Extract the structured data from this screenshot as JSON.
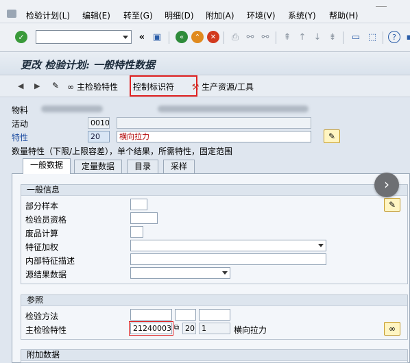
{
  "menu": {
    "items": [
      "检验计划(L)",
      "编辑(E)",
      "转至(G)",
      "明细(D)",
      "附加(A)",
      "环境(V)",
      "系统(Y)",
      "帮助(H)"
    ]
  },
  "toolbar": {
    "command_value": "",
    "icons": [
      "enter-icon",
      "back-icon",
      "save-icon",
      "back-green-icon",
      "exit-icon",
      "cancel-icon",
      "print-icon",
      "find-icon",
      "find-next-icon",
      "first-page-icon",
      "prev-page-icon",
      "next-page-icon",
      "last-page-icon",
      "new-session-icon",
      "shortcut-icon",
      "help-icon",
      "customize-icon"
    ]
  },
  "title": "更改 检验计划: 一般特性数据",
  "app_toolbar": {
    "master_char_label": "主检验特性",
    "control_indicator_label": "控制标识符",
    "prt_label": "生产资源/工具"
  },
  "header": {
    "material_label": "物料",
    "operation_label": "活动",
    "operation_value": "0010",
    "characteristic_label": "特性",
    "characteristic_value": "20",
    "characteristic_text": "横向拉力",
    "description": "数量特性（下限/上限容差），单个结果，所需特性，固定范围"
  },
  "tabs": [
    "一般数据",
    "定量数据",
    "目录",
    "采样"
  ],
  "general_info": {
    "title": "一般信息",
    "partial_sample_label": "部分样本",
    "inspector_qual_label": "检验员资格",
    "scrap_calc_label": "废品计算",
    "char_weighting_label": "特征加权",
    "internal_desc_label": "内部特征描述",
    "source_result_label": "源结果数据"
  },
  "reference": {
    "title": "参照",
    "method_label": "检验方法",
    "master_char_label": "主检验特性",
    "master_char_value": "21240003",
    "plant_value": "20",
    "version_value": "1",
    "master_char_text": "横向拉力"
  },
  "additional": {
    "title": "附加数据"
  },
  "colors": {
    "highlight": "#e02020",
    "title_text": "#1a2a3a",
    "characteristic_text": "#b00000"
  }
}
